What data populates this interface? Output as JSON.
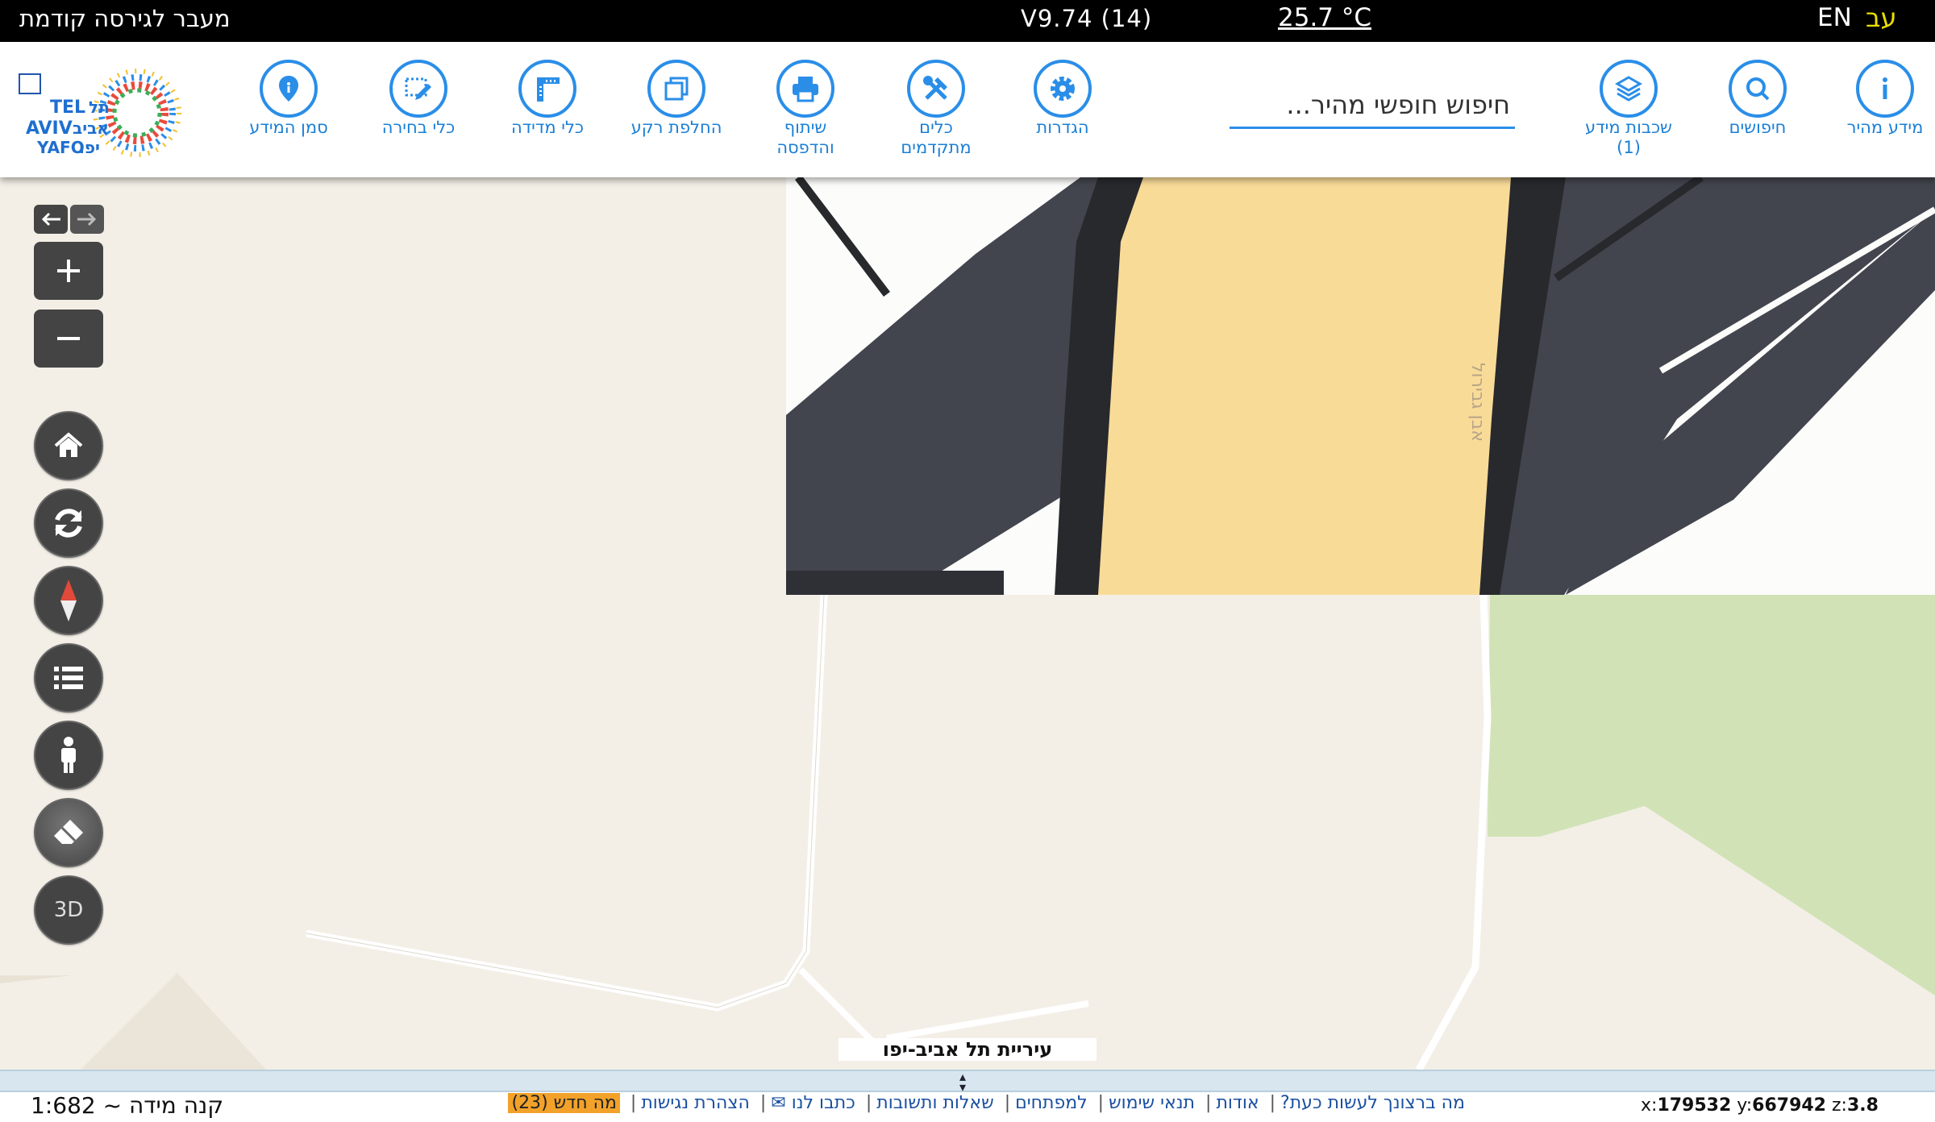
{
  "topbar": {
    "prev_version": "מעבר לגירסה קודמת",
    "version": "V9.74 (14)",
    "temperature": "25.7 °C",
    "lang_en": "EN",
    "lang_he": "עב"
  },
  "toolbar": {
    "quick_info": "מידע מהיר",
    "searches": "חיפושים",
    "layers": "שכבות מידע",
    "layers_count": "(1)",
    "search_placeholder": "חיפוש חופשי מהיר...",
    "settings": "הגדרות",
    "advanced_tools_1": "כלים",
    "advanced_tools_2": "מתקדמים",
    "share_1": "שיתוף",
    "share_2": "והדפסה",
    "basemap": "החלפת רקע",
    "measure": "כלי מדידה",
    "select": "כלי בחירה",
    "info_marker": "סמן המידע"
  },
  "logo": {
    "text_tel": "TEL",
    "text_aviv": "AVIV",
    "text_yafo": "YAFO",
    "text_he1": "תל",
    "text_he2": "אביב",
    "text_he3": "יפו"
  },
  "map": {
    "label": "עיריית תל אביב-יפו",
    "street_name": "אבן גבירול",
    "colors": {
      "land": "#f3efe7",
      "road": "#f9db98",
      "dark": "#42454d",
      "green": "#d1e3b6"
    }
  },
  "controls": {
    "three_d": "3D"
  },
  "footer": {
    "scale": "קנה מידה ~ 1:682",
    "links": [
      "מה ברצונך לעשות כעת?",
      "אודות",
      "תנאי שימוש",
      "למפתחים",
      "שאלות ותשובות",
      "כתבו לנו ✉",
      "הצהרת נגישות"
    ],
    "whats_new": "מה חדש (23)",
    "coord_x_label": "x:",
    "coord_x": "179532",
    "coord_y_label": "y:",
    "coord_y": "667942",
    "coord_z_label": "z:",
    "coord_z": "3.8"
  }
}
